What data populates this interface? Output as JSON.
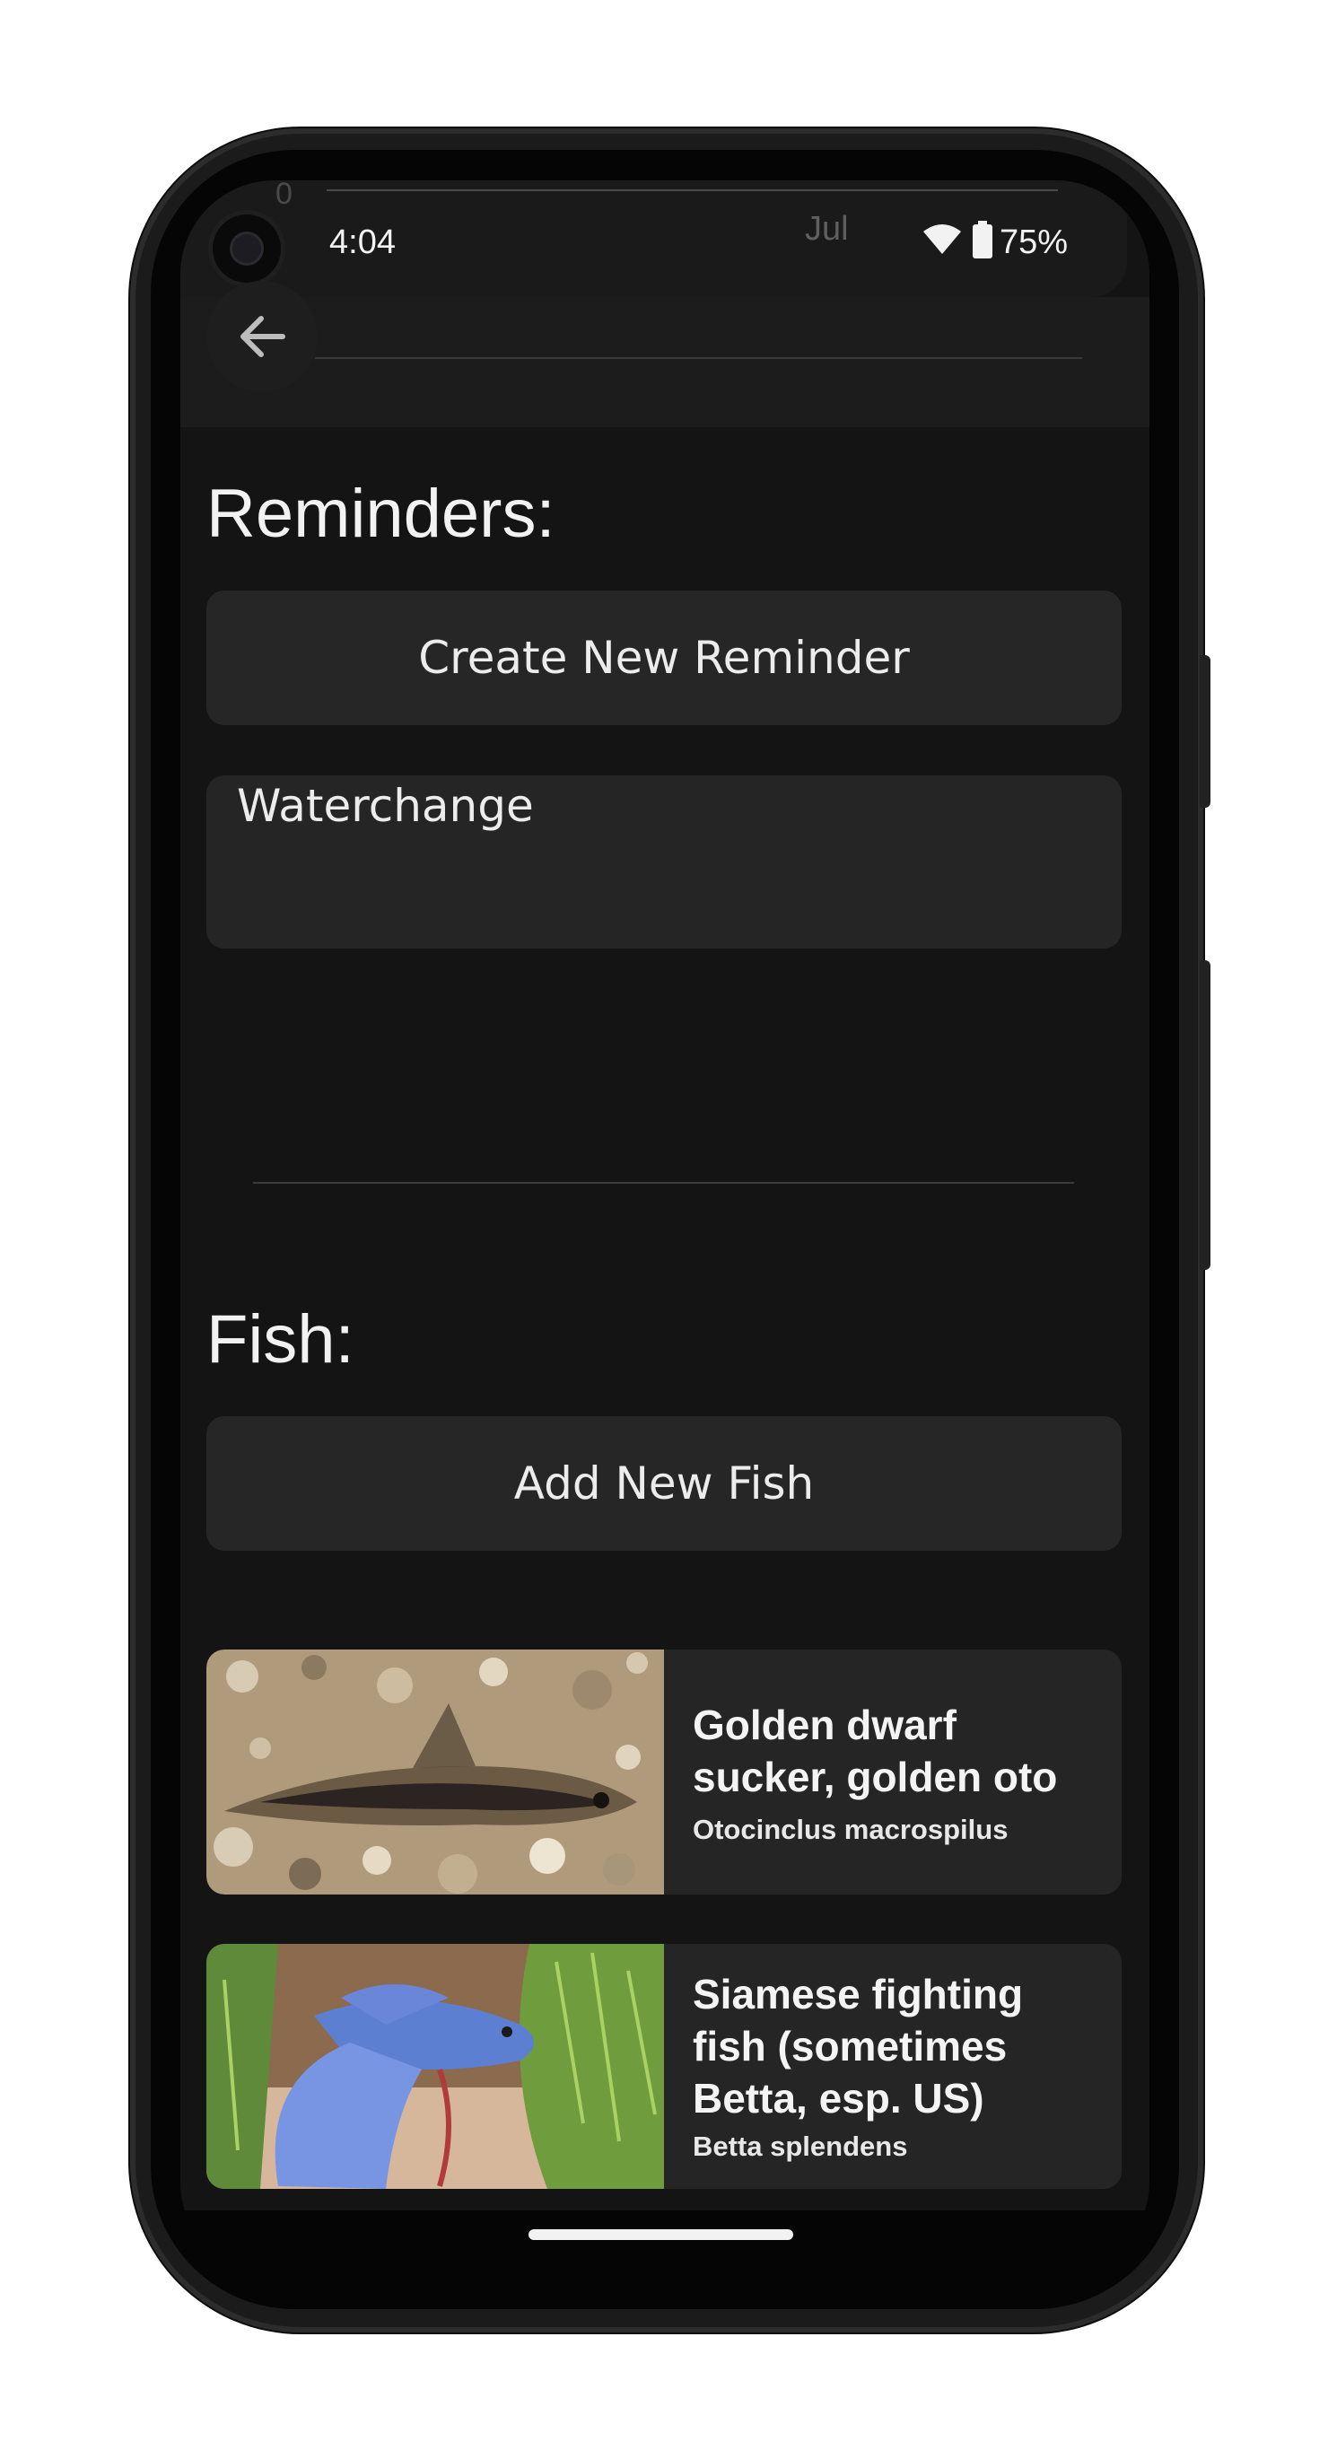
{
  "status_bar": {
    "indicator": "0",
    "time": "4:04",
    "month": "Jul",
    "battery": "75%",
    "icons": [
      "wifi-icon",
      "battery-icon"
    ]
  },
  "app_bar": {
    "back_icon": "arrow-left-icon"
  },
  "reminders": {
    "title": "Reminders:",
    "create_label": "Create New Reminder",
    "items": [
      {
        "label": "Waterchange"
      }
    ]
  },
  "fish": {
    "title": "Fish:",
    "add_label": "Add New Fish",
    "items": [
      {
        "common_name": "Golden dwarf sucker, golden oto",
        "scientific_name": "Otocinclus macrospilus"
      },
      {
        "common_name": "Siamese fighting fish (sometimes Betta, esp. US)",
        "scientific_name": "Betta splendens"
      }
    ]
  },
  "colors": {
    "background": "#141414",
    "surface": "#252525",
    "text": "#f2f2f2"
  }
}
